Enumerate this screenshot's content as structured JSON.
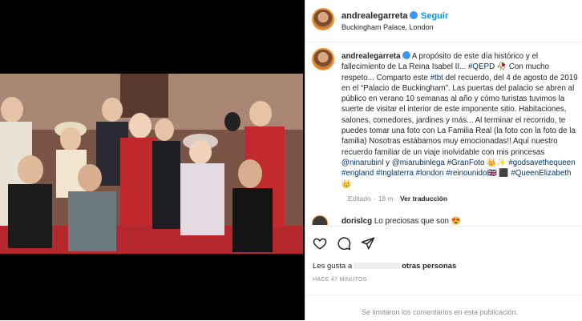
{
  "header": {
    "username": "andrealegarreta",
    "follow_label": "Seguir",
    "location": "Buckingham Palace, London"
  },
  "caption": {
    "username": "andrealegarreta",
    "text_1": "A propósito de este día histórico y el fallecimiento de La Reina Isabel II...",
    "tag_qepd": "#QEPD",
    "text_2": "🥀 Con mucho respeto... Comparto este",
    "tag_tbt": "#tbt",
    "text_3": "del recuerdo, del 4 de agosto de 2019 en el “Palacio de Buckingham”. Las puertas del palacio se abren al público en verano 10 semanas al año y cómo turistas tuvimos la suerte de visitar el interior de este imponente sitio. Habitaciones, salones, comedores, jardines y más... Al terminar el recorrido, te puedes tomar una foto con La Familia Real (la foto con la foto de la familia) Nosotras estábamos muy emocionadas!! Aquí nuestro recuerdo familiar de un viaje inolvidable con mis princesas",
    "mention_1": "@ninarubinl",
    "text_4": "y",
    "mention_2": "@miarubinlega",
    "tag_granfoto": "#GranFoto",
    "text_5": "👑✨",
    "tag_gsq": "#godsavethequeen",
    "tag_england": "#england",
    "tag_inglaterra": "#Inglaterra",
    "tag_london": "#london",
    "tag_reinounido": "#reinounido🇬🇧",
    "text_6": "⬛",
    "tag_qe": "#QueenElizabeth",
    "text_7": "👑",
    "edited": "Editado",
    "time": "18 m",
    "translate": "Ver traducción"
  },
  "comment": {
    "username": "dorislcg",
    "text": "Lo preciosas que son 😍"
  },
  "likes": {
    "prefix": "Les gusta a",
    "suffix": "otras personas"
  },
  "ago": "HACE 47 MINUTOS",
  "comments_closed": "Se limitaron los comentarios en esta publicación.",
  "carousel": {
    "pages": 3,
    "current": 1
  },
  "colors": {
    "link": "#00376b",
    "follow": "#0095f6",
    "verified": "#3897f0"
  }
}
